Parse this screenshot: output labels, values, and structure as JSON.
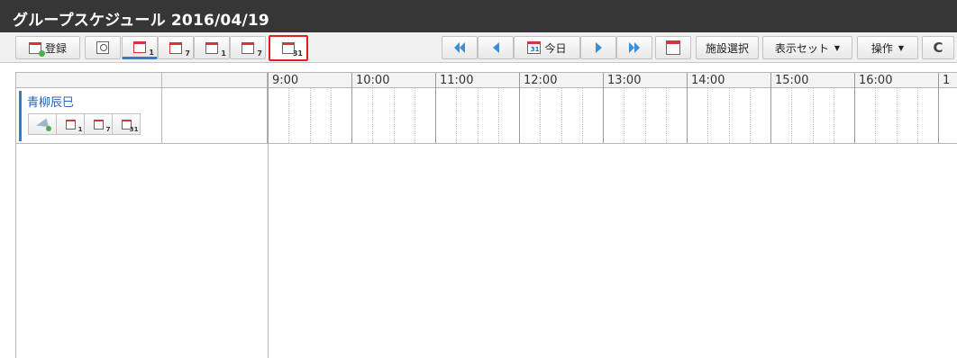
{
  "title": "グループスケジュール 2016/04/19",
  "toolbar": {
    "register_label": "登録",
    "today_label": "今日",
    "today_icon_number": "31",
    "facility_label": "施設選択",
    "display_set_label": "表示セット",
    "operation_label": "操作",
    "view_buttons": [
      {
        "icon": "calendar-group-day-icon",
        "sub": "1"
      },
      {
        "icon": "calendar-group-week-icon",
        "sub": "7"
      },
      {
        "icon": "calendar-personal-day-icon",
        "sub": "1"
      },
      {
        "icon": "calendar-personal-week-icon",
        "sub": "7"
      },
      {
        "icon": "calendar-personal-month-icon",
        "sub": "31"
      }
    ],
    "accent_color": "#3b79c5",
    "highlight_color": "#e02020"
  },
  "timeline": {
    "hours": [
      "9:00",
      "10:00",
      "11:00",
      "12:00",
      "13:00",
      "14:00",
      "15:00",
      "16:00",
      "1"
    ]
  },
  "users": [
    {
      "name": "青柳辰巳",
      "mini_buttons": [
        {
          "icon": "send-add-icon",
          "sub": ""
        },
        {
          "icon": "calendar-day-icon",
          "sub": "1"
        },
        {
          "icon": "calendar-week-icon",
          "sub": "7"
        },
        {
          "icon": "calendar-month-icon",
          "sub": "31"
        }
      ]
    }
  ]
}
